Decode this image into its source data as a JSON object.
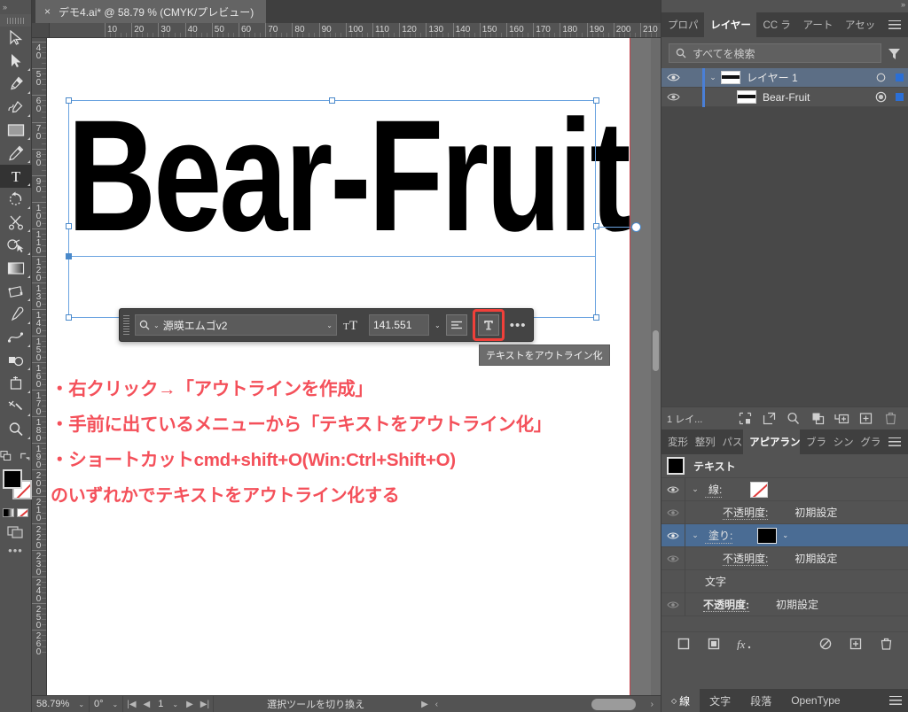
{
  "app": {
    "document_tab": "デモ4.ai* @ 58.79 % (CMYK/プレビュー)",
    "close_glyph": "×",
    "collapse_glyph": "»"
  },
  "toolbar": {
    "tools": [
      {
        "name": "selection-tool",
        "label": "選択ツール"
      },
      {
        "name": "direct-selection-tool",
        "label": "ダイレクト選択ツール"
      },
      {
        "name": "pen-tool",
        "label": "ペンツール"
      },
      {
        "name": "curvature-tool",
        "label": "曲線ツール"
      },
      {
        "name": "rectangle-tool",
        "label": "長方形ツール"
      },
      {
        "name": "pencil-tool",
        "label": "鉛筆ツール"
      },
      {
        "name": "type-tool",
        "label": "文字ツール"
      },
      {
        "name": "rotate-tool",
        "label": "回転ツール"
      },
      {
        "name": "scissors-tool",
        "label": "はさみツール"
      },
      {
        "name": "shape-builder-tool",
        "label": "シェイプ形成ツール"
      },
      {
        "name": "gradient-tool",
        "label": "グラデーションツール"
      },
      {
        "name": "free-transform-tool",
        "label": "自由変形ツール"
      },
      {
        "name": "eyedropper-tool",
        "label": "スポイトツール"
      },
      {
        "name": "blend-tool",
        "label": "ブレンドツール"
      },
      {
        "name": "symbol-sprayer-tool",
        "label": "シンボルスプレーツール"
      },
      {
        "name": "artboard-tool",
        "label": "アートボードツール"
      },
      {
        "name": "slice-tool",
        "label": "スライスツール"
      },
      {
        "name": "zoom-tool",
        "label": "ズームツール"
      }
    ],
    "active_tool": "type-tool",
    "fill_color": "#000000",
    "stroke_color": "none",
    "more_tools_glyph": "•••"
  },
  "rulers": {
    "horizontal_ticks": [
      10,
      20,
      30,
      40,
      50,
      60,
      70,
      80,
      90,
      100,
      110,
      120,
      130,
      140,
      150,
      160,
      170,
      180,
      190,
      200,
      210
    ],
    "vertical_ticks": [
      40,
      50,
      60,
      70,
      80,
      90,
      100,
      110,
      120,
      130,
      140,
      150,
      160,
      170,
      180,
      190,
      200,
      210,
      220,
      230,
      240,
      250,
      260
    ],
    "unit": "mm"
  },
  "canvas": {
    "artwork_text": "Bear-Fruit",
    "artboard_color": "#ffffff",
    "selection_color": "#6aa3e0"
  },
  "text_toolbar": {
    "font_name": "源暎エムゴv2",
    "font_size": "141.551",
    "font_size_icon": "font-size-icon",
    "search_glyph": "search-icon",
    "chevron_glyph": "⌄",
    "paragraph_button": "paragraph-align-icon",
    "outline_button": "create-outlines-icon",
    "more_glyph": "•••",
    "tooltip": "テキストをアウトライン化",
    "highlight_color": "#f0403a"
  },
  "annotation": {
    "color": "#f4505a",
    "lines": [
      "・右クリック→「アウトラインを作成」",
      "・手前に出ているメニューから「テキストをアウトライン化」",
      "・ショートカットcmd+shift+O(Win:Ctrl+Shift+O)",
      "のいずれかでテキストをアウトライン化する"
    ]
  },
  "right_panel": {
    "top_tabs": [
      {
        "label": "プロパ",
        "name": "tab-properties",
        "active": false
      },
      {
        "label": "レイヤー",
        "name": "tab-layers",
        "active": true
      },
      {
        "label": "CC ラ",
        "name": "tab-cc-libraries",
        "active": false
      },
      {
        "label": "アート",
        "name": "tab-artboards",
        "active": false
      },
      {
        "label": "アセッ",
        "name": "tab-assets",
        "active": false
      }
    ],
    "search_placeholder": "すべてを検索",
    "layers": [
      {
        "name": "レイヤー 1",
        "selected": true,
        "expanded": true,
        "visible": true,
        "target_filled": false
      },
      {
        "name": "Bear-Fruit",
        "selected": false,
        "expanded": false,
        "visible": true,
        "target_filled": true
      }
    ],
    "layers_footer_count": "1 レイ...",
    "layers_footer_icons": [
      "locate-object-icon",
      "release-to-layers-icon",
      "find-icon",
      "collect-in-new-layer-icon",
      "new-sublayer-icon",
      "new-layer-icon",
      "delete-layer-icon"
    ],
    "appearance_tabs": [
      {
        "label": "変形",
        "name": "tab-transform",
        "active": false
      },
      {
        "label": "整列",
        "name": "tab-align",
        "active": false
      },
      {
        "label": "パス",
        "name": "tab-pathfinder",
        "active": false
      },
      {
        "label": "アピアランス",
        "name": "tab-appearance",
        "active": true
      },
      {
        "label": "ブラ",
        "name": "tab-brushes",
        "active": false
      },
      {
        "label": "シン",
        "name": "tab-symbols",
        "active": false
      },
      {
        "label": "グラ",
        "name": "tab-graphic-styles",
        "active": false
      }
    ],
    "appearance": {
      "object_type": "テキスト",
      "object_swatch": "#000000",
      "rows": [
        {
          "label": "線:",
          "value": "",
          "swatch": "none",
          "selected": false,
          "indent": 0,
          "has_arrow": true,
          "has_eye": true
        },
        {
          "label": "不透明度:",
          "value": "初期設定",
          "swatch": null,
          "selected": false,
          "indent": 1,
          "has_arrow": false,
          "has_eye": true
        },
        {
          "label": "塗り:",
          "value": "",
          "swatch": "#000000",
          "selected": true,
          "indent": 0,
          "has_arrow": true,
          "has_eye": true
        },
        {
          "label": "不透明度:",
          "value": "初期設定",
          "swatch": null,
          "selected": false,
          "indent": 1,
          "has_arrow": false,
          "has_eye": true
        },
        {
          "label": "文字",
          "value": "",
          "swatch": null,
          "selected": false,
          "indent": 2,
          "has_arrow": false,
          "has_eye": false
        },
        {
          "label": "不透明度:",
          "value": "初期設定",
          "swatch": null,
          "selected": false,
          "indent": 2,
          "has_arrow": false,
          "has_eye": true
        }
      ]
    },
    "appearance_footer_icons": [
      "add-new-stroke-icon",
      "add-new-fill-icon",
      "add-effect-icon",
      "clear-appearance-icon",
      "duplicate-item-icon",
      "delete-item-icon"
    ],
    "bottom_tabs": [
      {
        "label": "線",
        "name": "tab-stroke",
        "active": true
      },
      {
        "label": "文字",
        "name": "tab-character",
        "active": false
      },
      {
        "label": "段落",
        "name": "tab-paragraph",
        "active": false
      },
      {
        "label": "OpenType",
        "name": "tab-opentype",
        "active": false
      }
    ]
  },
  "status_bar": {
    "zoom": "58.79%",
    "rotation": "0°",
    "page": "1",
    "message": "選択ツールを切り換え",
    "chevron": "⌄",
    "first_glyph": "|◀",
    "prev_glyph": "◀",
    "next_glyph": "▶",
    "last_glyph": "▶|",
    "play_glyph": "▶"
  }
}
